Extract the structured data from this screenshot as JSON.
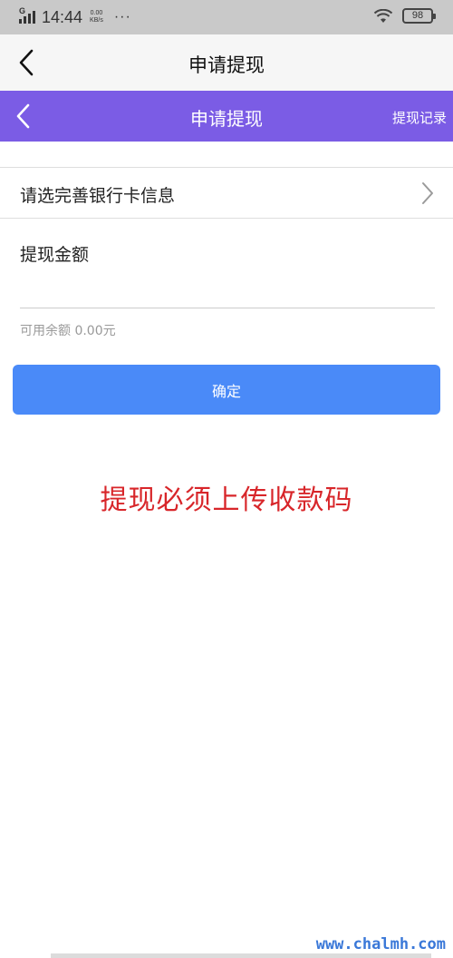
{
  "status_bar": {
    "network_type": "G",
    "time": "14:44",
    "speed_value": "0.00",
    "speed_unit": "KB/s",
    "dots": "···",
    "battery_level": "98"
  },
  "app_header": {
    "title": "申请提现",
    "back_icon": "chevron-left-icon"
  },
  "webview_header": {
    "title": "申请提现",
    "record_link": "提现记录",
    "background_color": "#7b5ce5",
    "back_icon": "chevron-left-icon"
  },
  "bank_card_row": {
    "label": "请选完善银行卡信息",
    "arrow_icon": "chevron-right-icon"
  },
  "withdraw_form": {
    "amount_label": "提现金额",
    "amount_value": "",
    "amount_placeholder": "",
    "balance_text": "可用余额 0.00元"
  },
  "confirm_button": {
    "label": "确定",
    "color": "#4a8af8"
  },
  "notice": {
    "text": "提现必须上传收款码",
    "color": "#d8262a"
  },
  "watermark": {
    "text": "www.chalmh.com"
  }
}
